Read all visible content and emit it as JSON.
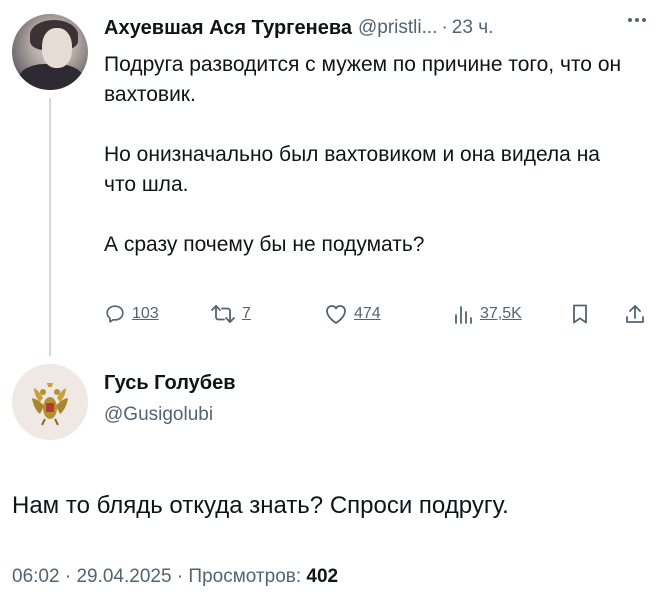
{
  "tweet1": {
    "author_name": "Ахуевшая Ася Тургенева",
    "author_handle": "@pristli...",
    "separator": "·",
    "time": "23 ч.",
    "body": [
      "Подруга разводится с мужем по причине того, что он вахтовик.",
      "Но онизначально был вахтовиком и она видела на что шла.",
      "А сразу почему бы не подумать?"
    ],
    "actions": {
      "replies": "103",
      "retweets": "7",
      "likes": "474",
      "views": "37,5K"
    },
    "icons": {
      "more": "more-horizontal-icon",
      "reply": "reply-icon",
      "retweet": "retweet-icon",
      "like": "heart-icon",
      "views": "analytics-icon",
      "bookmark": "bookmark-icon",
      "share": "share-icon"
    }
  },
  "tweet2": {
    "author_name": "Гусь Голубев",
    "author_handle": "@Gusigolubi",
    "body": "Нам то блядь откуда знать? Спроси подругу."
  },
  "meta": {
    "time": "06:02",
    "separator1": "·",
    "date": "29.04.2025",
    "separator2": "·",
    "views_label": "Просмотров:",
    "views_count": "402"
  },
  "colors": {
    "text": "#0f1419",
    "secondary": "#536471",
    "thread_line": "#cfd9de"
  }
}
